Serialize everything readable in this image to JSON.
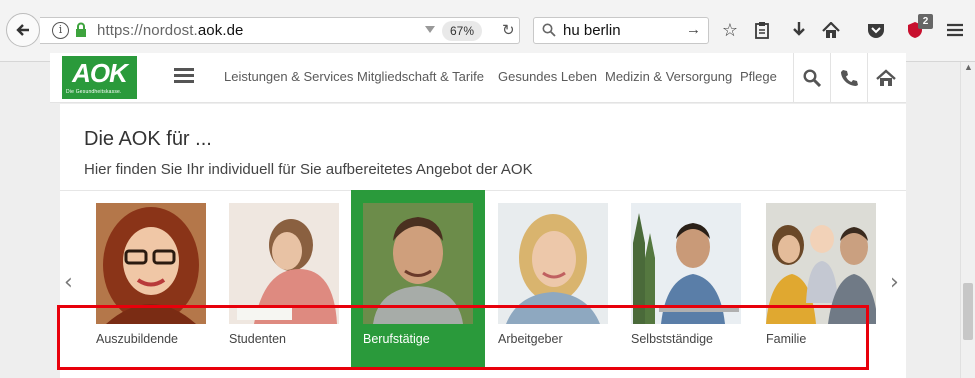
{
  "browser": {
    "url_prefix": "https://nordost.",
    "url_domain": "aok.de",
    "zoom": "67%",
    "search_query": "hu berlin",
    "addon_badge": "2"
  },
  "site": {
    "logo_text": "AOK",
    "logo_sub": "Die Gesundheitskasse.",
    "nav": [
      {
        "label": "Leistungen & Services"
      },
      {
        "label": "Mitgliedschaft & Tarife"
      },
      {
        "label": "Gesundes Leben"
      },
      {
        "label": "Medizin & Versorgung"
      },
      {
        "label": "Pflege"
      }
    ]
  },
  "section": {
    "title": "Die AOK für ...",
    "subtitle": "Hier finden Sie Ihr individuell für Sie aufbereitetes Angebot der AOK"
  },
  "carousel": {
    "prev_arrow": "‹",
    "next_arrow": "›",
    "items": [
      {
        "label": "Auszubildende"
      },
      {
        "label": "Studenten"
      },
      {
        "label": "Berufstätige"
      },
      {
        "label": "Arbeitgeber"
      },
      {
        "label": "Selbstständige"
      },
      {
        "label": "Familie"
      }
    ]
  },
  "colors": {
    "brand_green": "#2a9a3b",
    "highlight_red": "#e8000b"
  }
}
